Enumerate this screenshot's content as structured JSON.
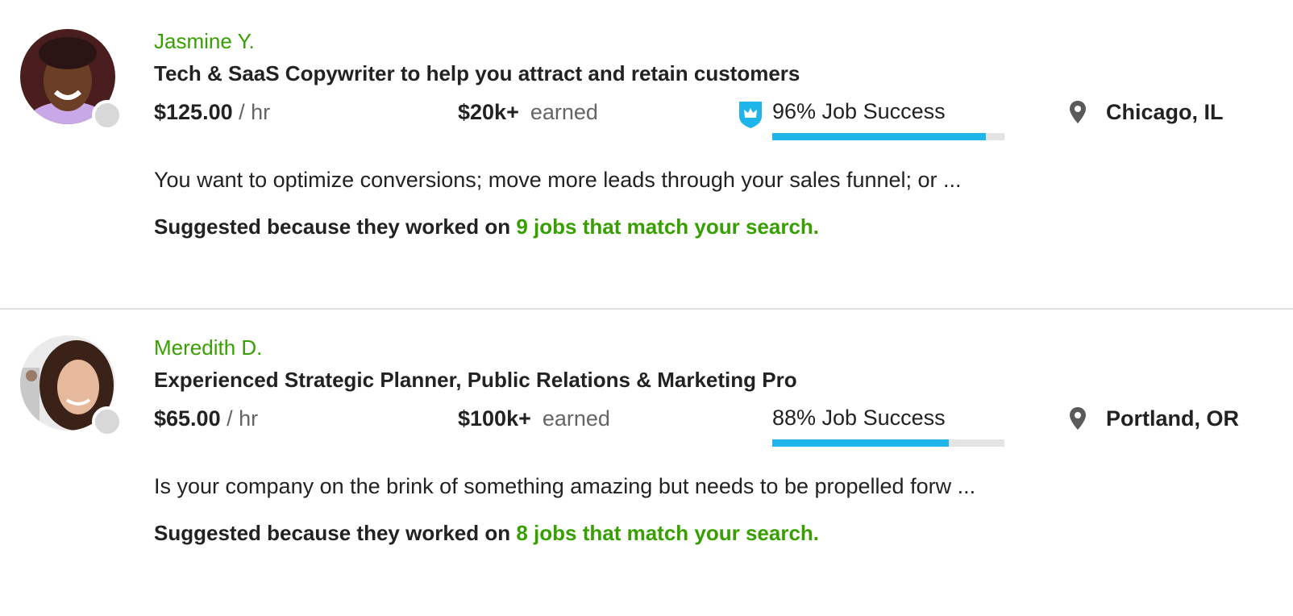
{
  "colors": {
    "name_green": "#37a000",
    "progress_blue": "#1fb5ea",
    "progress_track": "#e4e4e4",
    "text_dark": "#222222",
    "text_muted": "#656565",
    "badge_blue": "#1fb5ea",
    "pin_gray": "#5a5a5a",
    "divider": "#e0e0e0"
  },
  "freelancers": [
    {
      "name": "Jasmine Y.",
      "title": "Tech & SaaS Copywriter to help you attract and retain customers",
      "rate": "$125.00",
      "rate_unit": "/ hr",
      "earned": "$20k+",
      "earned_label": "earned",
      "has_top_rated_badge": true,
      "badge_icon": "top-rated-shield-crown-icon",
      "job_success": "96% Job Success",
      "job_success_pct": 92,
      "location_icon": "map-pin-icon",
      "location": "Chicago, IL",
      "description": "You want to optimize conversions; move more leads through your sales funnel; or ...",
      "suggest_prefix": "Suggested because they worked on",
      "suggest_link": "9 jobs that match your search."
    },
    {
      "name": "Meredith D.",
      "title": "Experienced Strategic Planner, Public Relations & Marketing Pro",
      "rate": "$65.00",
      "rate_unit": "/ hr",
      "earned": "$100k+",
      "earned_label": "earned",
      "has_top_rated_badge": false,
      "job_success": "88% Job Success",
      "job_success_pct": 76,
      "location_icon": "map-pin-icon",
      "location": "Portland, OR",
      "description": "Is your company on the brink of something amazing but needs to be propelled forw ...",
      "suggest_prefix": "Suggested because they worked on",
      "suggest_link": "8 jobs that match your search."
    }
  ]
}
